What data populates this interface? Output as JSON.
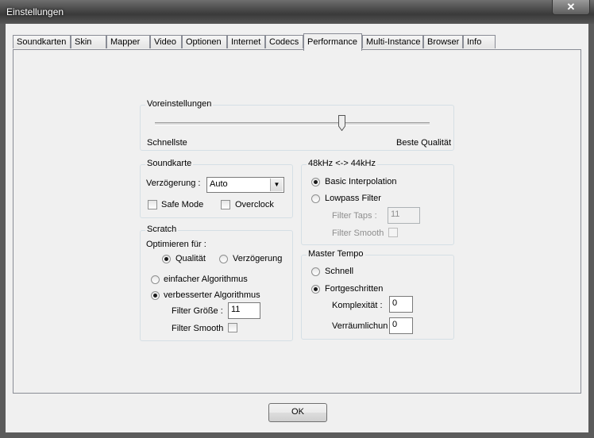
{
  "window": {
    "title": "Einstellungen",
    "close_glyph": "✕"
  },
  "tabs": [
    {
      "label": "Soundkarten",
      "active": false
    },
    {
      "label": "Skin",
      "active": false
    },
    {
      "label": "Mapper",
      "active": false
    },
    {
      "label": "Video",
      "active": false
    },
    {
      "label": "Optionen",
      "active": false
    },
    {
      "label": "Internet",
      "active": false
    },
    {
      "label": "Codecs",
      "active": false
    },
    {
      "label": "Performance",
      "active": true
    },
    {
      "label": "Multi-Instance",
      "active": false
    },
    {
      "label": "Browser",
      "active": false
    },
    {
      "label": "Info",
      "active": false
    }
  ],
  "presets": {
    "title": "Voreinstellungen",
    "min_label": "Schnellste",
    "max_label": "Beste Qualität",
    "level": 0.68
  },
  "soundcard": {
    "title": "Soundkarte",
    "latency_label": "Verzögerung :",
    "latency_value": "Auto",
    "safe_mode_label": "Safe Mode",
    "safe_mode_checked": false,
    "overclock_label": "Overclock",
    "overclock_checked": false
  },
  "scratch": {
    "title": "Scratch",
    "optimize_label": "Optimieren für :",
    "quality_label": "Qualität",
    "quality_selected": true,
    "latency_label": "Verzögerung",
    "latency_selected": false,
    "simple_algo_label": "einfacher Algorithmus",
    "simple_algo_selected": false,
    "improved_algo_label": "verbesserter Algorithmus",
    "improved_algo_selected": true,
    "filter_size_label": "Filter Größe :",
    "filter_size_value": "11",
    "filter_smooth_label": "Filter Smooth",
    "filter_smooth_checked": false
  },
  "resample": {
    "title": "48kHz <-> 44kHz",
    "basic_label": "Basic Interpolation",
    "basic_selected": true,
    "lowpass_label": "Lowpass Filter",
    "lowpass_selected": false,
    "filter_taps_label": "Filter Taps :",
    "filter_taps_value": "11",
    "filter_smooth_label": "Filter Smooth"
  },
  "master_tempo": {
    "title": "Master Tempo",
    "fast_label": "Schnell",
    "fast_selected": false,
    "advanced_label": "Fortgeschritten",
    "advanced_selected": true,
    "complexity_label": "Komplexität :",
    "complexity_value": "0",
    "blur_label": "Verräumlichung",
    "blur_value": "0"
  },
  "ok_label": "OK"
}
